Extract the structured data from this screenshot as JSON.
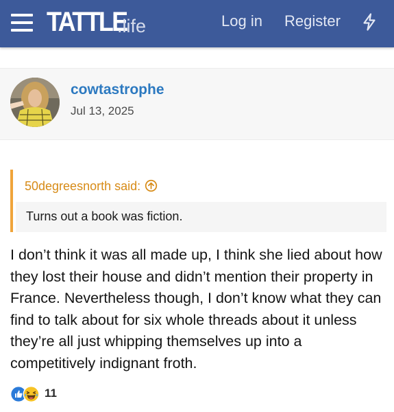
{
  "header": {
    "logo_main": "TATTLE",
    "logo_suffix": ".life",
    "login_label": "Log in",
    "register_label": "Register",
    "menu_icon": "hamburger-menu-icon",
    "whats_new_icon": "lightning-bolt-icon",
    "background_color": "#3d5a9a"
  },
  "post": {
    "author": "cowtastrophe",
    "date": "Jul 13, 2025",
    "quote": {
      "author_said": "50degreesnorth said:",
      "text": "Turns out a book was fiction.",
      "jump_icon": "circle-arrow-up-icon",
      "accent_color": "#f0a43a"
    },
    "message": "I don’t think it was all made up, I think she lied about how they lost their house and didn’t mention their property in France. Nevertheless though, I don’t know what they can find to talk about for six whole threads about it unless they’re all just whipping themselves up into a competitively indignant froth.",
    "reactions": {
      "icons": [
        "thumbs-up-icon",
        "laughing-emoji-icon"
      ],
      "count": "11"
    }
  }
}
